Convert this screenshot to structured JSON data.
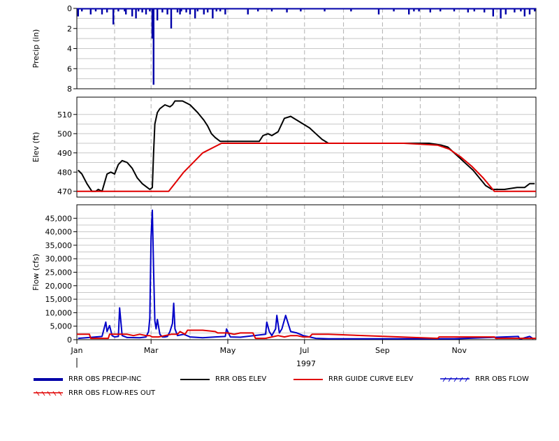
{
  "chart_data": [
    {
      "type": "bar",
      "ylabel": "Precip (in)",
      "ylim": [
        8,
        0
      ],
      "yticks": [
        0,
        2,
        4,
        6,
        8
      ],
      "color": "#0000a8",
      "x": [
        1,
        4,
        11,
        15,
        20,
        24,
        29,
        33,
        38,
        39,
        44,
        47,
        49,
        52,
        55,
        58,
        60,
        61,
        64,
        68,
        72,
        75,
        80,
        82,
        83,
        87,
        90,
        94,
        96,
        101,
        104,
        108,
        111,
        114,
        118,
        136,
        144,
        155,
        167,
        178,
        197,
        218,
        240,
        252,
        264,
        268,
        272,
        281,
        289,
        300,
        311,
        316,
        324,
        331,
        337,
        341,
        348,
        353,
        356,
        360,
        364
      ],
      "values": [
        0.8,
        0.3,
        0.6,
        0.3,
        0.6,
        0.4,
        1.6,
        0.3,
        0.3,
        0.6,
        0.8,
        1.0,
        0.3,
        0.4,
        0.6,
        0.3,
        3.0,
        7.6,
        1.2,
        0.4,
        0.6,
        2.0,
        0.4,
        0.6,
        0.3,
        0.4,
        0.6,
        1.0,
        0.3,
        0.6,
        0.4,
        1.0,
        0.3,
        0.3,
        0.6,
        0.6,
        0.3,
        0.3,
        0.4,
        0.3,
        0.3,
        0.3,
        0.6,
        0.3,
        0.6,
        0.3,
        0.3,
        0.4,
        0.3,
        0.3,
        0.4,
        0.3,
        0.4,
        0.8,
        1.0,
        0.6,
        0.4,
        0.3,
        0.8,
        0.6,
        0.3
      ]
    },
    {
      "type": "line",
      "ylabel": "Elev (ft)",
      "ylim": [
        467,
        519
      ],
      "yticks": [
        470,
        480,
        490,
        500,
        510
      ],
      "series": [
        {
          "name": "RRR OBS ELEV",
          "color": "#000000",
          "x": [
            1,
            4,
            8,
            12,
            15,
            17,
            20,
            24,
            27,
            30,
            33,
            36,
            40,
            44,
            48,
            52,
            56,
            58,
            60,
            61,
            62,
            64,
            66,
            70,
            74,
            76,
            78,
            80,
            84,
            90,
            96,
            101,
            104,
            107,
            110,
            114,
            120,
            130,
            140,
            145,
            148,
            152,
            155,
            160,
            165,
            170,
            175,
            180,
            185,
            190,
            195,
            200,
            260,
            280,
            290,
            295,
            300,
            305,
            310,
            315,
            320,
            325,
            330,
            333,
            340,
            350,
            356,
            360,
            364
          ],
          "values": [
            481,
            479,
            474,
            470,
            470,
            471,
            470,
            479,
            480,
            479,
            484,
            486,
            485,
            482,
            477,
            474,
            472,
            471,
            472,
            490,
            505,
            511,
            513,
            515,
            514,
            515,
            517,
            517,
            517,
            515,
            511,
            507,
            504,
            500,
            498,
            496,
            496,
            496,
            496,
            496,
            499,
            500,
            499,
            501,
            508,
            509,
            507,
            505,
            503,
            500,
            497,
            495,
            495,
            495,
            494,
            493,
            490,
            487,
            484,
            481,
            477,
            473,
            471,
            471,
            471,
            472,
            472,
            474,
            474
          ]
        },
        {
          "name": "RRR GUIDE CURVE ELEV",
          "color": "#e00000",
          "x": [
            0,
            73,
            85,
            100,
            115,
            260,
            287,
            296,
            305,
            314,
            323,
            332,
            365
          ],
          "values": [
            470,
            470,
            480,
            490,
            495,
            495,
            494,
            492,
            488,
            483,
            477,
            470,
            470
          ]
        }
      ]
    },
    {
      "type": "line",
      "ylabel": "Flow (cfs)",
      "ylim": [
        0,
        50000
      ],
      "yticks": [
        0,
        5000,
        10000,
        15000,
        20000,
        25000,
        30000,
        35000,
        40000,
        45000
      ],
      "xlabel": "1997",
      "xticks": [
        "Jan",
        "Mar",
        "May",
        "Jul",
        "Sep",
        "Nov"
      ],
      "xtick_days": [
        0,
        59,
        120,
        181,
        243,
        304
      ],
      "series": [
        {
          "name": "RRR OBS FLOW",
          "color": "#0000c8",
          "x": [
            1,
            10,
            20,
            23,
            24,
            26,
            28,
            30,
            33,
            34,
            36,
            40,
            50,
            55,
            57,
            58,
            59,
            60,
            61,
            62,
            63,
            64,
            66,
            68,
            70,
            72,
            74,
            76,
            77,
            78,
            80,
            85,
            90,
            100,
            110,
            118,
            119,
            122,
            130,
            150,
            151,
            153,
            155,
            158,
            159,
            161,
            163,
            166,
            170,
            175,
            180,
            185,
            190,
            200,
            300,
            351,
            352,
            353,
            360,
            363
          ],
          "values": [
            500,
            800,
            1200,
            6500,
            3000,
            5200,
            1500,
            1000,
            1200,
            11800,
            1500,
            800,
            700,
            1000,
            3000,
            8000,
            38000,
            48000,
            26000,
            7000,
            4000,
            7500,
            2000,
            1000,
            1000,
            1200,
            3000,
            6000,
            13500,
            4000,
            1500,
            2000,
            1000,
            700,
            1000,
            1200,
            4000,
            1000,
            900,
            2000,
            6500,
            3000,
            1500,
            4000,
            9000,
            2500,
            4000,
            9000,
            3000,
            2500,
            1500,
            1000,
            500,
            300,
            300,
            1200,
            300,
            300,
            1200,
            300
          ]
        },
        {
          "name": "RRR OBS FLOW-RES OUT",
          "color": "#e00000",
          "x": [
            0,
            10,
            11,
            25,
            26,
            40,
            45,
            50,
            55,
            58,
            60,
            65,
            70,
            75,
            80,
            82,
            86,
            88,
            95,
            100,
            110,
            112,
            120,
            125,
            130,
            140,
            142,
            150,
            155,
            160,
            165,
            170,
            175,
            180,
            185,
            187,
            195,
            200,
            287,
            288,
            332,
            333,
            365
          ],
          "values": [
            2000,
            2000,
            500,
            500,
            2000,
            2000,
            1500,
            2000,
            1500,
            1500,
            1000,
            1000,
            1500,
            2000,
            2000,
            3000,
            2000,
            3500,
            3500,
            3500,
            3000,
            2500,
            2500,
            2000,
            2500,
            2500,
            500,
            500,
            1000,
            1500,
            1000,
            1500,
            1500,
            1000,
            1000,
            2000,
            2000,
            2000,
            500,
            1000,
            1000,
            500,
            500
          ]
        }
      ]
    }
  ],
  "legend": {
    "items": [
      {
        "label": "RRR OBS PRECIP-INC"
      },
      {
        "label": "RRR OBS ELEV"
      },
      {
        "label": "RRR GUIDE CURVE ELEV"
      },
      {
        "label": "RRR OBS FLOW"
      },
      {
        "label": "RRR OBS FLOW-RES OUT"
      }
    ]
  }
}
